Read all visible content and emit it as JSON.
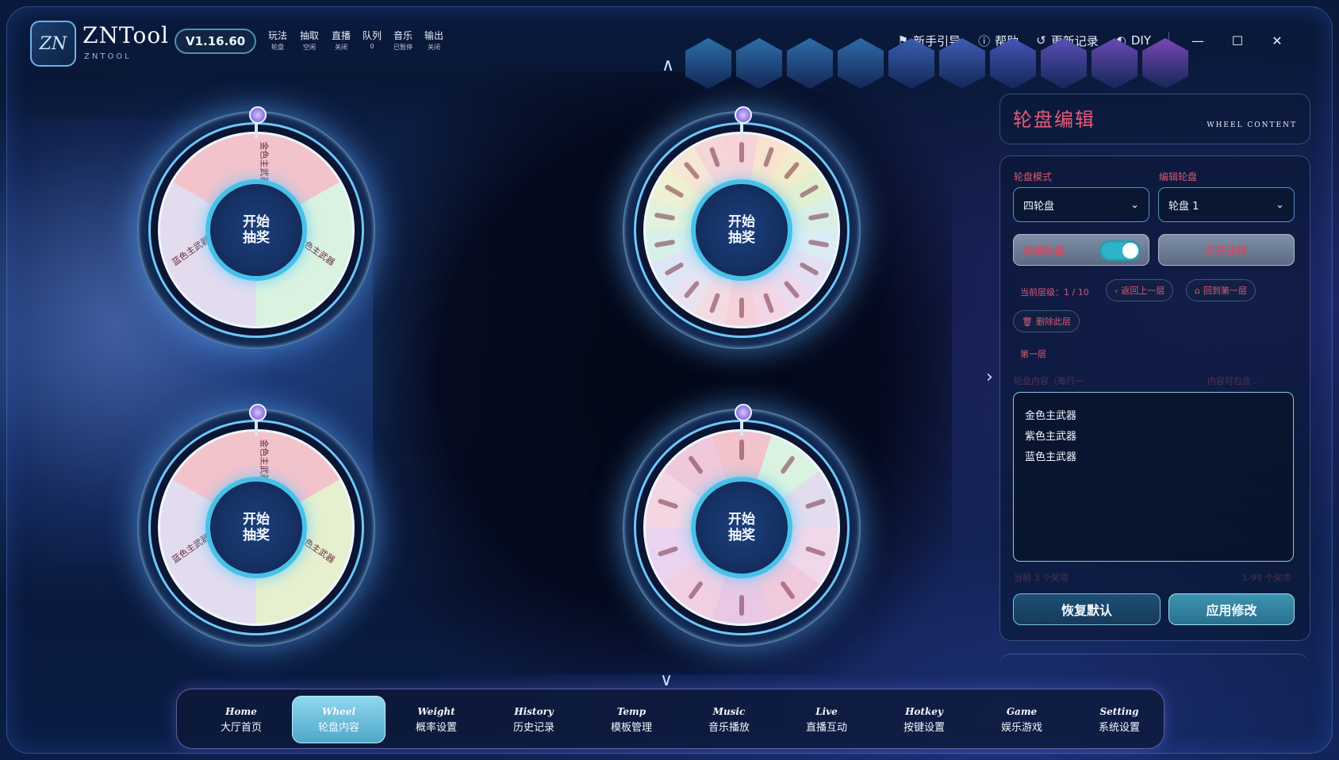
{
  "app": {
    "name": "ZNTool",
    "subtitle": "ZNTOOL",
    "logo_text": "ZN",
    "version": "V1.16.60"
  },
  "status_items": [
    {
      "label": "玩法",
      "value": "轮盘"
    },
    {
      "label": "抽取",
      "value": "空闲"
    },
    {
      "label": "直播",
      "value": "关闭"
    },
    {
      "label": "队列",
      "value": "0"
    },
    {
      "label": "音乐",
      "value": "已暂停"
    },
    {
      "label": "输出",
      "value": "关闭"
    }
  ],
  "header_actions": [
    {
      "label": "新手引导",
      "icon": "guide-icon"
    },
    {
      "label": "帮助",
      "icon": "help-icon"
    },
    {
      "label": "更新记录",
      "icon": "history-icon"
    },
    {
      "label": "DIY",
      "icon": "palette-icon"
    }
  ],
  "hex_colors": [
    "#2d6fa8",
    "#2d6fa8",
    "#2f6ca8",
    "#2f6aa8",
    "#3a5fae",
    "#3f5db2",
    "#4655b6",
    "#5a4fb6",
    "#6a4ab6",
    "#7847b4"
  ],
  "wheels": [
    {
      "center_text": "开始抽奖",
      "segments": [
        "金色主武器",
        "紫色主武器",
        "蓝色主武器"
      ],
      "colors": [
        "#f3c3cc",
        "#daf3e0",
        "#e3dcef"
      ]
    },
    {
      "center_text": "开始抽奖",
      "segments": [],
      "colors": [
        "#f6d3d8",
        "#f8e3cf",
        "#f1ecca",
        "#e2f0d2",
        "#d8efe6",
        "#dcecf4",
        "#e2e0f2",
        "#ecdaee",
        "#f3d6e6",
        "#f5d2da",
        "#f3dbe2",
        "#e9e3f1",
        "#dde6f4",
        "#d9f0ea",
        "#e3f2dc",
        "#f0f0d2",
        "#f6e6d4",
        "#f4d6d9"
      ]
    },
    {
      "center_text": "开始抽奖",
      "segments": [
        "金色主武器",
        "紫色主武器",
        "蓝色主武器"
      ],
      "colors": [
        "#f3c3cc",
        "#e6f0cf",
        "#e3dcef"
      ]
    },
    {
      "center_text": "开始抽奖",
      "segments": [],
      "colors": [
        "#f3c3cc",
        "#daf3e0",
        "#e3dcef",
        "#f1d7ea",
        "#f0c9dc",
        "#e8c8e4",
        "#f0cfe3",
        "#ead4ef",
        "#f3d6e2",
        "#efc8dc"
      ]
    }
  ],
  "panel": {
    "title": "轮盘编辑",
    "subtitle": "WHEEL CONTENT",
    "mode_label": "轮盘模式",
    "mode_value": "四轮盘",
    "edit_label": "编辑轮盘",
    "edit_value": "轮盘 1",
    "multilayer_label": "多层轮盘",
    "multilayer_on": true,
    "open_notes": "打开注释",
    "current_level": "当前层级：1 / 10",
    "back_btn": "返回上一层",
    "first_btn": "回到第一层",
    "delete_btn": "删除此层",
    "layer_name": "第一层",
    "content_hint": "轮盘内容（每行一",
    "content_hint_right": "内容可包含…",
    "items": [
      "金色主武器",
      "紫色主武器",
      "蓝色主武器"
    ],
    "count_left": "当前 3 个奖项",
    "count_right": "1-99 个奖项",
    "reset_btn": "恢复默认",
    "apply_btn": "应用修改"
  },
  "nav": [
    {
      "en": "Home",
      "cn": "大厅首页",
      "active": false
    },
    {
      "en": "Wheel",
      "cn": "轮盘内容",
      "active": true
    },
    {
      "en": "Weight",
      "cn": "概率设置",
      "active": false
    },
    {
      "en": "History",
      "cn": "历史记录",
      "active": false
    },
    {
      "en": "Temp",
      "cn": "模板管理",
      "active": false
    },
    {
      "en": "Music",
      "cn": "音乐播放",
      "active": false
    },
    {
      "en": "Live",
      "cn": "直播互动",
      "active": false
    },
    {
      "en": "Hotkey",
      "cn": "按键设置",
      "active": false
    },
    {
      "en": "Game",
      "cn": "娱乐游戏",
      "active": false
    },
    {
      "en": "Setting",
      "cn": "系统设置",
      "active": false
    }
  ]
}
